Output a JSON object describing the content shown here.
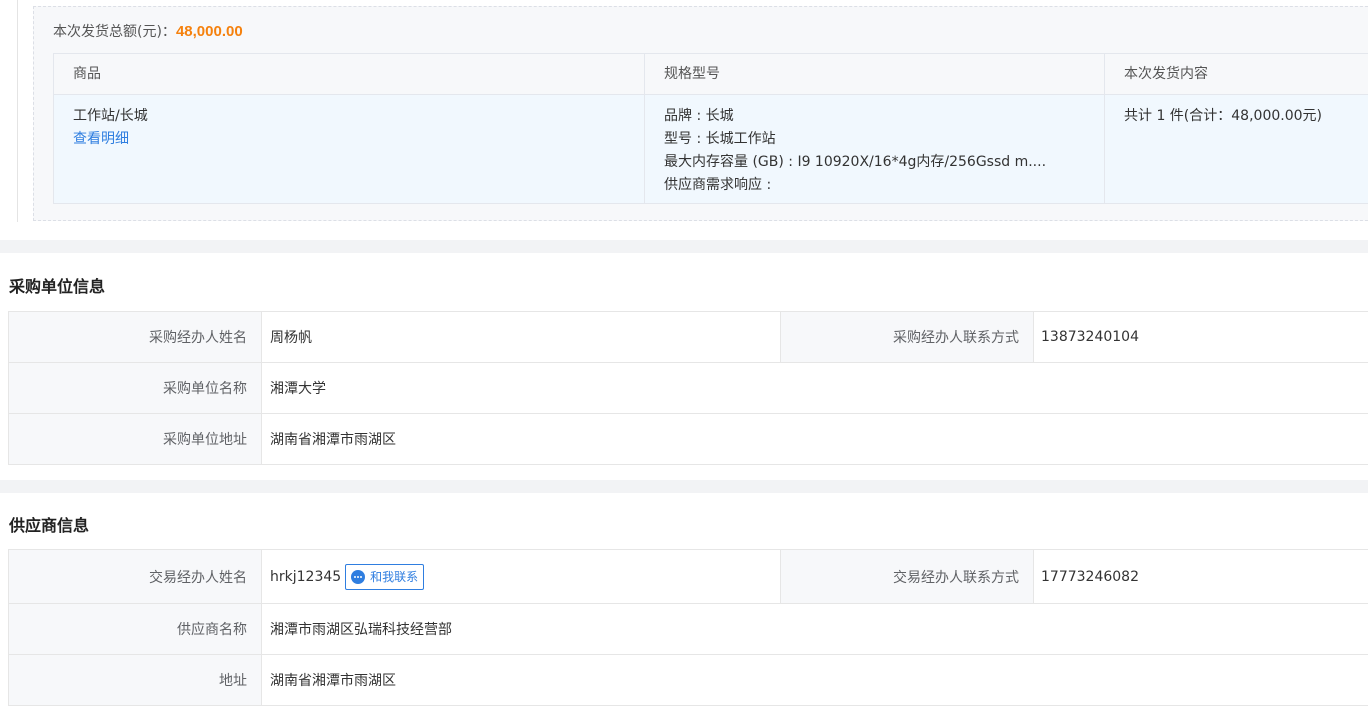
{
  "shipment": {
    "total_label": "本次发货总额(元)：",
    "total_amount": "48,000.00",
    "table": {
      "headers": [
        "商品",
        "规格型号",
        "本次发货内容"
      ],
      "row": {
        "product_name": "工作站/长城",
        "detail_link": "查看明细",
        "specs": [
          "品牌 : 长城",
          "型号 : 长城工作站",
          "最大内存容量 (GB) : I9 10920X/16*4g内存/256Gssd m....",
          "供应商需求响应 :"
        ],
        "content": "共计 1 件(合计：48,000.00元)"
      }
    }
  },
  "buyer": {
    "section_title": "采购单位信息",
    "agent_name_label": "采购经办人姓名",
    "agent_name": "周杨帆",
    "agent_phone_label": "采购经办人联系方式",
    "agent_phone": "13873240104",
    "org_name_label": "采购单位名称",
    "org_name": "湘潭大学",
    "org_address_label": "采购单位地址",
    "org_address": "湖南省湘潭市雨湖区"
  },
  "supplier": {
    "section_title": "供应商信息",
    "agent_name_label": "交易经办人姓名",
    "agent_name": "hrkj12345",
    "contact_button": "和我联系",
    "agent_phone_label": "交易经办人联系方式",
    "agent_phone": "17773246082",
    "name_label": "供应商名称",
    "name": "湘潭市雨湖区弘瑞科技经营部",
    "address_label": "地址",
    "address": "湖南省湘潭市雨湖区"
  },
  "colors": {
    "accent_orange": "#f5810d",
    "link_blue": "#2f7ee0"
  },
  "icons": {
    "contact": "chat-bubble-icon"
  }
}
